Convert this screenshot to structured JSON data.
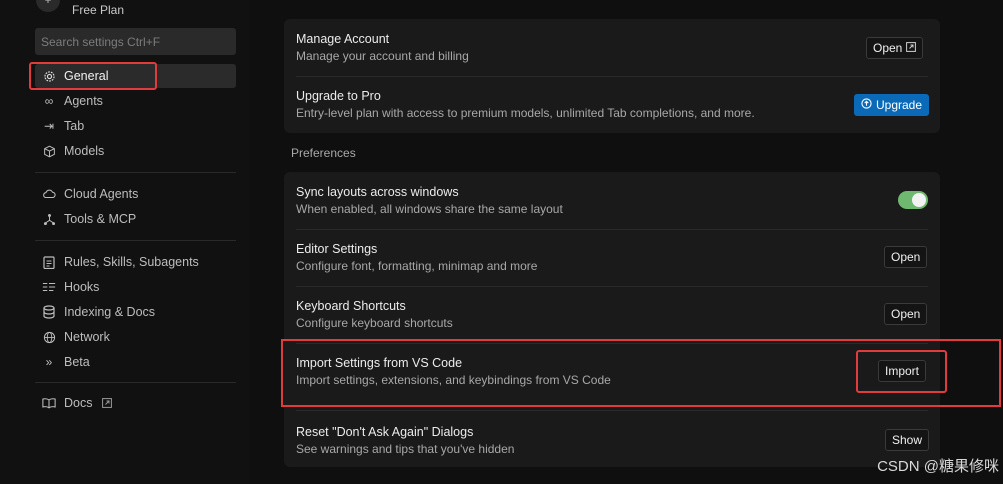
{
  "sidebar": {
    "plan": "Free Plan",
    "search_placeholder": "Search settings Ctrl+F",
    "items": [
      {
        "label": "General",
        "icon": "gear-icon"
      },
      {
        "label": "Agents",
        "icon": "infinity-icon"
      },
      {
        "label": "Tab",
        "icon": "tab-arrow-icon"
      },
      {
        "label": "Models",
        "icon": "cube-icon"
      },
      {
        "label": "Cloud Agents",
        "icon": "cloud-icon"
      },
      {
        "label": "Tools & MCP",
        "icon": "nodes-icon"
      },
      {
        "label": "Rules, Skills, Subagents",
        "icon": "clipboard-icon"
      },
      {
        "label": "Hooks",
        "icon": "hooks-icon"
      },
      {
        "label": "Indexing & Docs",
        "icon": "database-icon"
      },
      {
        "label": "Network",
        "icon": "globe-icon"
      },
      {
        "label": "Beta",
        "icon": "chevrons-right-icon"
      },
      {
        "label": "Docs",
        "icon": "book-icon"
      }
    ]
  },
  "account": {
    "manage_title": "Manage Account",
    "manage_desc": "Manage your account and billing",
    "manage_btn": "Open",
    "upgrade_title": "Upgrade to Pro",
    "upgrade_desc": "Entry-level plan with access to premium models, unlimited Tab completions, and more.",
    "upgrade_btn": "Upgrade"
  },
  "preferences": {
    "label": "Preferences",
    "sync_title": "Sync layouts across windows",
    "sync_desc": "When enabled, all windows share the same layout",
    "sync_enabled": true,
    "editor_title": "Editor Settings",
    "editor_desc": "Configure font, formatting, minimap and more",
    "editor_btn": "Open",
    "keyboard_title": "Keyboard Shortcuts",
    "keyboard_desc": "Configure keyboard shortcuts",
    "keyboard_btn": "Open",
    "import_title": "Import Settings from VS Code",
    "import_desc": "Import settings, extensions, and keybindings from VS Code",
    "import_btn": "Import",
    "reset_title": "Reset \"Don't Ask Again\" Dialogs",
    "reset_desc": "See warnings and tips that you've hidden",
    "reset_btn": "Show"
  },
  "watermark": "CSDN @糖果修咪",
  "colors": {
    "accent": "#0a6ab8",
    "toggle_on": "#6fb86f",
    "highlight": "#e23b3b"
  }
}
